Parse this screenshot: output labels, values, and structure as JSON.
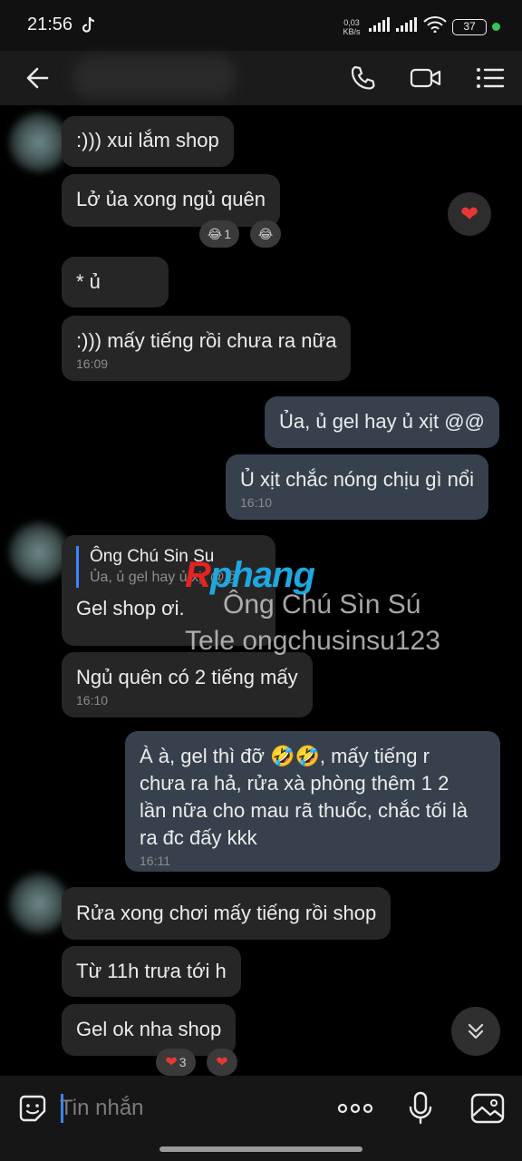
{
  "status_bar": {
    "time": "21:56",
    "net_speed_value": "0,03",
    "net_speed_unit": "KB/s",
    "battery": "37"
  },
  "header": {
    "contact_name": ""
  },
  "messages": [
    {
      "dir": "in",
      "text": ":))) xui lắm shop"
    },
    {
      "dir": "in",
      "text": "Lở ủa xong ngủ quên",
      "reaction_count": "1"
    },
    {
      "dir": "in",
      "text": "* ủ"
    },
    {
      "dir": "in",
      "text": ":))) mấy tiếng rồi chưa ra nữa",
      "time": "16:09"
    },
    {
      "dir": "out",
      "text": "Ủa, ủ gel hay ủ xịt @@"
    },
    {
      "dir": "out",
      "text": "Ủ xịt chắc nóng chịu gì nổi",
      "time": "16:10"
    },
    {
      "dir": "in",
      "reply_to_name": "Ông Chú Sin Su",
      "reply_to_text": "Ủa, ủ gel hay ủ xịt @@",
      "text": "Gel shop ơi."
    },
    {
      "dir": "in",
      "text": "Ngủ quên có 2 tiếng mấy",
      "time": "16:10"
    },
    {
      "dir": "out",
      "lines": [
        "À à, gel thì đỡ 🤣🤣, mấy tiếng r",
        "chưa ra hả, rửa xà phòng thêm 1 2",
        "lần nữa cho mau rã thuốc, chắc tối là",
        "ra đc đấy kkk"
      ],
      "time": "16:11"
    },
    {
      "dir": "in",
      "text": "Rửa xong chơi mấy tiếng rồi shop"
    },
    {
      "dir": "in",
      "text": "Từ 11h trưa tới h"
    },
    {
      "dir": "in",
      "text": "Gel ok nha shop",
      "reaction_count": "3"
    }
  ],
  "watermark": {
    "logo_r": "R",
    "logo_rest": "phang",
    "name": "Ông Chú Sìn Sú",
    "tele": "Tele ongchusinsu123"
  },
  "input": {
    "placeholder": "Tin nhắn"
  },
  "colors": {
    "incoming_bubble": "#262626",
    "outgoing_bubble": "#37414d",
    "accent": "#3a86ff",
    "reaction_heart": "#e53935"
  }
}
